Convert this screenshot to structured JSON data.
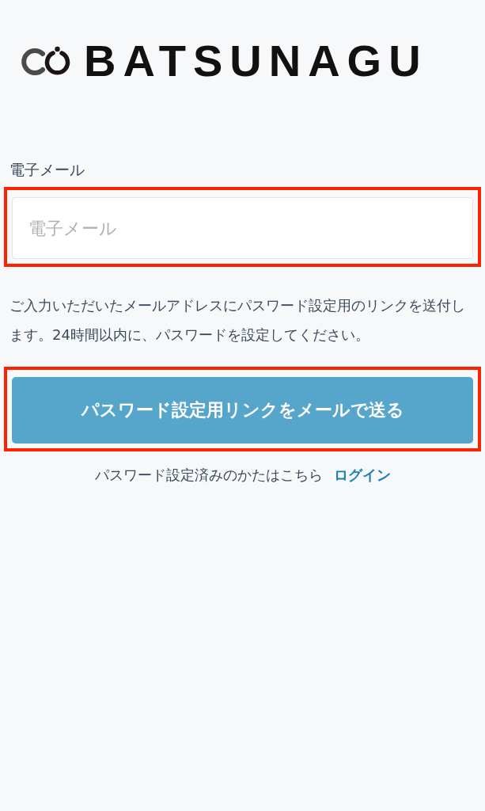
{
  "logo": {
    "text": "BATSUNAGU"
  },
  "email_field": {
    "label": "電子メール",
    "placeholder": "電子メール",
    "highlighted": true
  },
  "notice": "ご入力いただいたメールアドレスにパスワード設定用のリンクを送付します。24時間以内に、パスワードを設定してください。",
  "submit_button": {
    "label": "パスワード設定用リンクをメールで送る",
    "highlighted": true
  },
  "footer": {
    "text": "パスワード設定済みのかたはこちら",
    "link": "ログイン"
  }
}
